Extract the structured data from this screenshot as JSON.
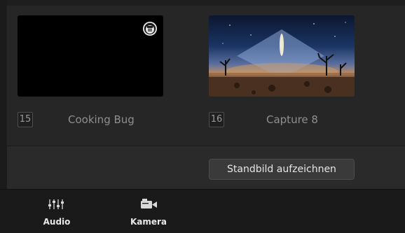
{
  "media_pool": {
    "items": [
      {
        "number": "15",
        "label": "Cooking Bug",
        "thumbnail": "black-frame-with-logo"
      },
      {
        "number": "16",
        "label": "Capture 8",
        "thumbnail": "desert-night-sky-with-diamond"
      }
    ],
    "logo_icon": "food-logo-icon"
  },
  "actions": {
    "capture_still_label": "Standbild aufzeichnen"
  },
  "tabs": [
    {
      "label": "Audio",
      "icon": "mixer-sliders-icon"
    },
    {
      "label": "Kamera",
      "icon": "camera-icon"
    }
  ],
  "colors": {
    "background": "#1e1e1e",
    "panel": "#262626",
    "button": "#3a3a3a",
    "text_primary": "#e6e6e6",
    "text_muted": "#8f8f8f"
  }
}
